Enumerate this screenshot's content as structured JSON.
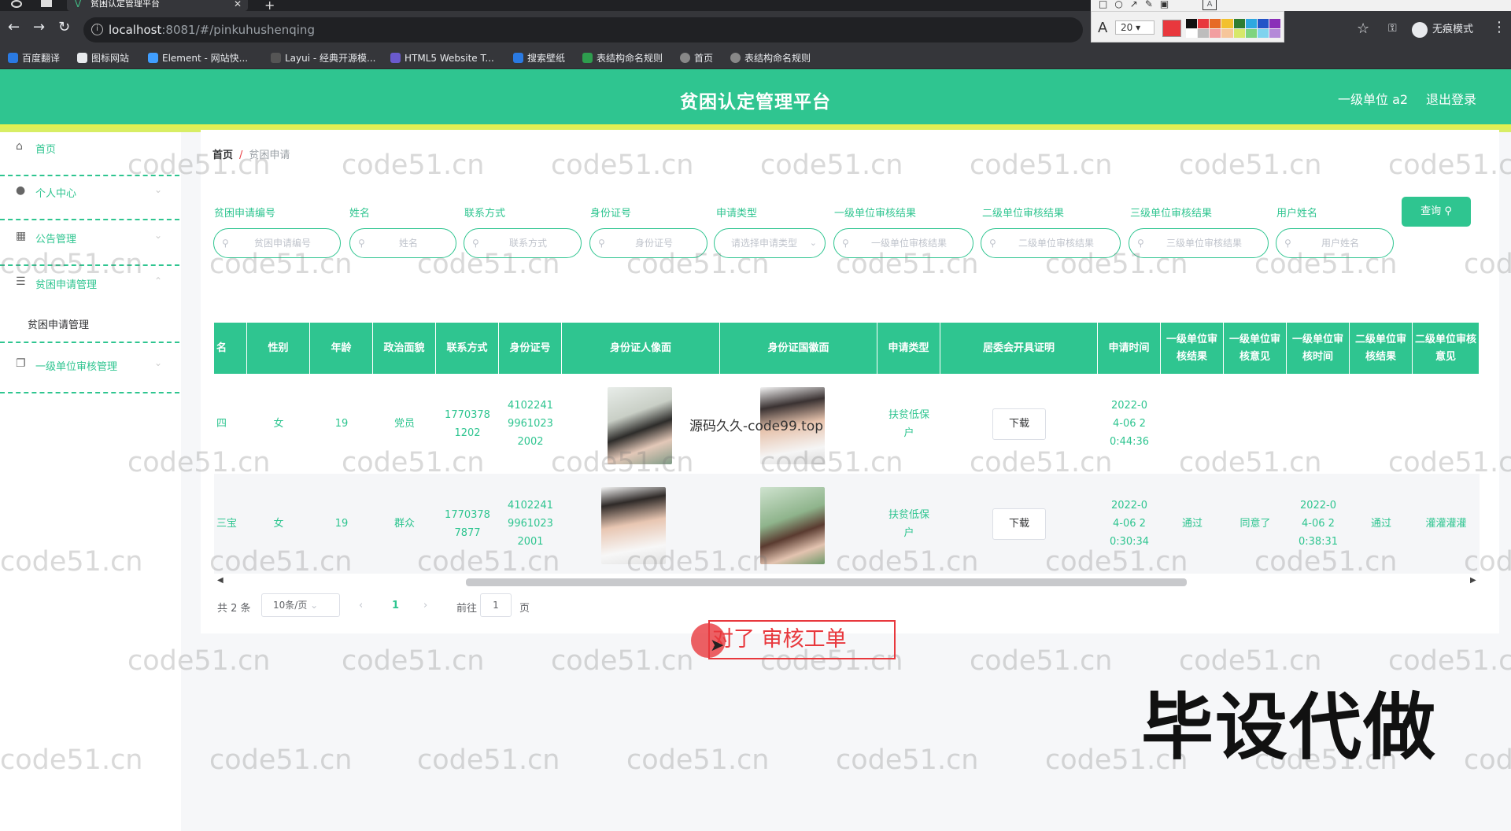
{
  "browser": {
    "tab_title": "贫困认定管理平台",
    "url_host": "localhost",
    "url_path": ":8081/#/pinkuhushenqing",
    "bookmarks": [
      "百度翻译",
      "图标网站",
      "Element - 网站快...",
      "Layui - 经典开源模...",
      "HTML5 Website T...",
      "搜索壁纸",
      "表结构命名规则",
      "首页",
      "表结构命名规则"
    ],
    "incognito_label": "无痕模式",
    "annotation_font_size": "20",
    "annotation_colors": [
      "#111111",
      "#e8383d",
      "#e66a25",
      "#f2c12e",
      "#2f7d32",
      "#2ea8e0",
      "#2453c7",
      "#8a2fb8",
      "#ffffff",
      "#bdbdbd",
      "#f29ea0",
      "#f6c69a",
      "#d7e86a",
      "#7fd47f",
      "#7fd3ee",
      "#b48ad8"
    ]
  },
  "header": {
    "title": "贫困认定管理平台",
    "user": "一级单位 a2",
    "logout": "退出登录"
  },
  "sidebar": {
    "items": [
      {
        "icon": "home-icon",
        "label": "首页"
      },
      {
        "icon": "user-icon",
        "label": "个人中心"
      },
      {
        "icon": "grid-icon",
        "label": "公告管理"
      },
      {
        "icon": "sliders-icon",
        "label": "贫困申请管理"
      },
      {
        "icon": "copy-icon",
        "label": "一级单位审核管理"
      }
    ],
    "submenu": "贫困申请管理"
  },
  "breadcrumb": {
    "home": "首页",
    "separator": "/",
    "current": "贫困申请"
  },
  "filters": [
    {
      "label": "贫困申请编号",
      "placeholder": "贫困申请编号"
    },
    {
      "label": "姓名",
      "placeholder": "姓名"
    },
    {
      "label": "联系方式",
      "placeholder": "联系方式"
    },
    {
      "label": "身份证号",
      "placeholder": "身份证号"
    },
    {
      "label": "申请类型",
      "placeholder": "请选择申请类型"
    },
    {
      "label": "一级单位审核结果",
      "placeholder": "一级单位审核结果"
    },
    {
      "label": "二级单位审核结果",
      "placeholder": "二级单位审核结果"
    },
    {
      "label": "三级单位审核结果",
      "placeholder": "三级单位审核结果"
    },
    {
      "label": "用户姓名",
      "placeholder": "用户姓名"
    }
  ],
  "query_button": "查询",
  "table": {
    "columns": [
      "名",
      "性别",
      "年龄",
      "政治面貌",
      "联系方式",
      "身份证号",
      "身份证人像面",
      "身份证国徽面",
      "申请类型",
      "居委会开具证明",
      "申请时间",
      "一级单位审核结果",
      "一级单位审核意见",
      "一级单位审核时间",
      "二级单位审核结果",
      "二级单位审核意见"
    ],
    "download_label": "下载",
    "rows": [
      {
        "name": "四",
        "gender": "女",
        "age": "19",
        "politics": "党员",
        "phone": "17703781202",
        "idcard": "410224199610232002",
        "apply_type": "扶贫低保户",
        "time": "2022-04-06 20:44:36",
        "l1_result": "",
        "l1_opinion": "",
        "l1_time": "",
        "l2_result": "",
        "l2_opinion": ""
      },
      {
        "name": "三宝",
        "gender": "女",
        "age": "19",
        "politics": "群众",
        "phone": "17703787877",
        "idcard": "410224199610232001",
        "apply_type": "扶贫低保户",
        "time": "2022-04-06 20:30:34",
        "l1_result": "通过",
        "l1_opinion": "同意了",
        "l1_time": "2022-04-06 20:38:31",
        "l2_result": "通过",
        "l2_opinion": "灌灌灌灌"
      }
    ]
  },
  "pagination": {
    "total": "共 2 条",
    "page_size": "10条/页",
    "prev": "‹",
    "current": "1",
    "next": "›",
    "goto_label": "前往",
    "goto_value": "1",
    "page_suffix": "页"
  },
  "overlay": {
    "inline_watermark": "源码久久-code99.top",
    "annotation_text": "对了  审核工单",
    "caption": "毕设代做",
    "site_watermark": "code51.cn"
  }
}
